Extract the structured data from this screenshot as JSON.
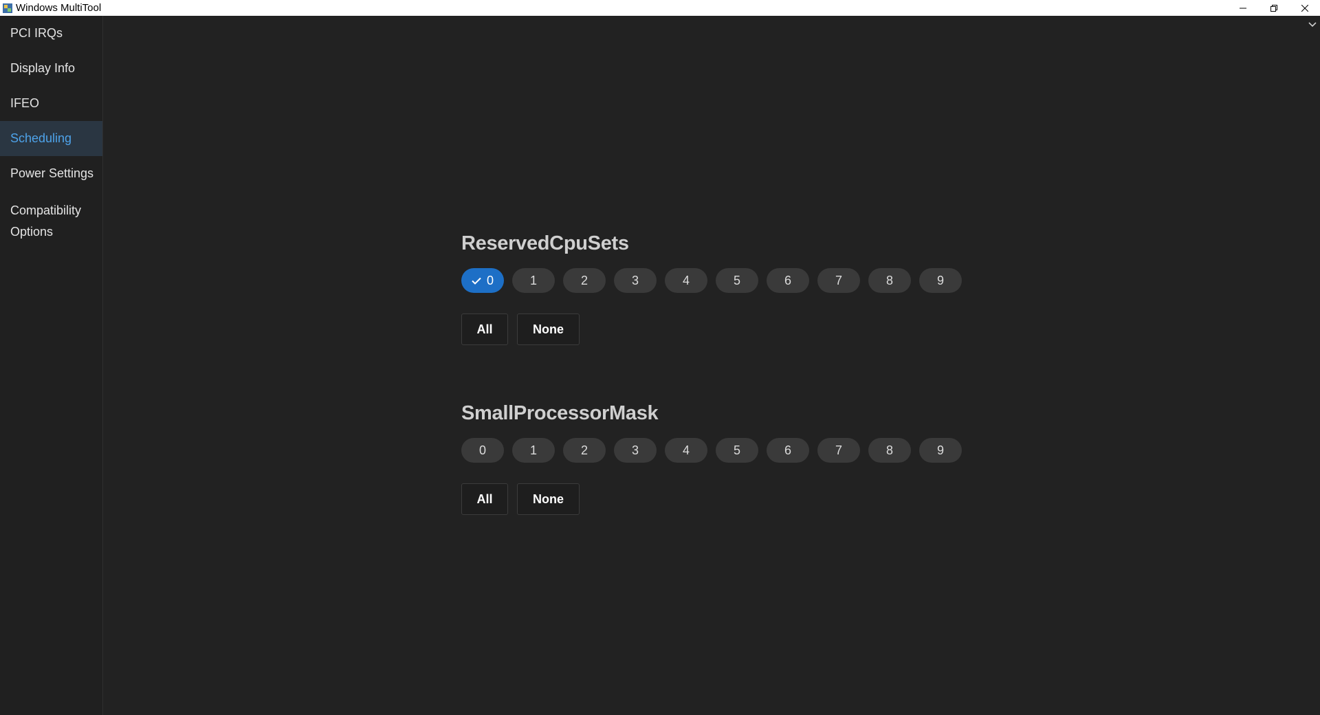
{
  "window": {
    "title": "Windows MultiTool",
    "controls": [
      "minimize-icon",
      "restore-icon",
      "close-icon"
    ]
  },
  "sidebar": {
    "items": [
      {
        "label": "PCI IRQs"
      },
      {
        "label": "Display Info"
      },
      {
        "label": "IFEO"
      },
      {
        "label": "Scheduling",
        "selected": true
      },
      {
        "label": "Power Settings"
      },
      {
        "label": "Compatibility Options"
      }
    ]
  },
  "sections": [
    {
      "title": "ReservedCpuSets",
      "cpus": [
        "0",
        "1",
        "2",
        "3",
        "4",
        "5",
        "6",
        "7",
        "8",
        "9"
      ],
      "checked": [
        "0"
      ],
      "all_label": "All",
      "none_label": "None"
    },
    {
      "title": "SmallProcessorMask",
      "cpus": [
        "0",
        "1",
        "2",
        "3",
        "4",
        "5",
        "6",
        "7",
        "8",
        "9"
      ],
      "checked": [],
      "all_label": "All",
      "none_label": "None"
    }
  ],
  "colors": {
    "accent": "#1d6fc6",
    "selected_nav_text": "#4ea3ea",
    "background": "#222222"
  }
}
